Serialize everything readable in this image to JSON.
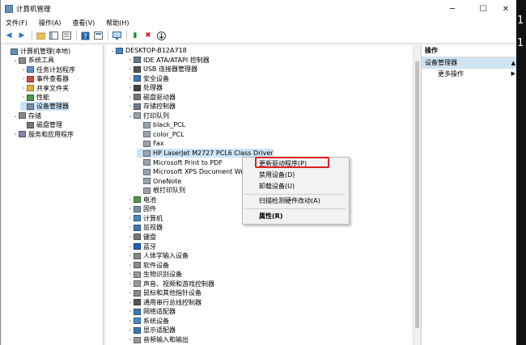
{
  "window": {
    "title": "计算机管理",
    "controls": {
      "minimize": "─",
      "maximize": "☐",
      "close": "✕"
    }
  },
  "menu": [
    "文件(F)",
    "操作(A)",
    "查看(V)",
    "帮助(H)"
  ],
  "left_tree": [
    {
      "label": "计算机管理(本地)",
      "level": 0,
      "icon": "computer-management-icon",
      "expand": ""
    },
    {
      "label": "系统工具",
      "level": 1,
      "icon": "tools-icon",
      "expand": "v"
    },
    {
      "label": "任务计划程序",
      "level": 2,
      "icon": "clock-icon",
      "expand": ">"
    },
    {
      "label": "事件查看器",
      "level": 2,
      "icon": "event-viewer-icon",
      "expand": ">"
    },
    {
      "label": "共享文件夹",
      "level": 2,
      "icon": "shared-folder-icon",
      "expand": ">"
    },
    {
      "label": "性能",
      "level": 2,
      "icon": "performance-icon",
      "expand": ">"
    },
    {
      "label": "设备管理器",
      "level": 2,
      "icon": "device-manager-icon",
      "expand": "",
      "selected": true
    },
    {
      "label": "存储",
      "level": 1,
      "icon": "storage-icon",
      "expand": "v"
    },
    {
      "label": "磁盘管理",
      "level": 2,
      "icon": "disk-icon",
      "expand": ""
    },
    {
      "label": "服务和应用程序",
      "level": 1,
      "icon": "services-icon",
      "expand": ">"
    }
  ],
  "device_tree": {
    "root": "DESKTOP-B12A718",
    "items": [
      {
        "label": "IDE ATA/ATAPI 控制器",
        "level": 1,
        "icon": "ide-controller-icon",
        "expand": ">"
      },
      {
        "label": "USB 连接器管理器",
        "level": 1,
        "icon": "usb-icon",
        "expand": ">"
      },
      {
        "label": "安全设备",
        "level": 1,
        "icon": "security-device-icon",
        "expand": ">"
      },
      {
        "label": "处理器",
        "level": 1,
        "icon": "processor-icon",
        "expand": ">"
      },
      {
        "label": "磁盘驱动器",
        "level": 1,
        "icon": "disk-drive-icon",
        "expand": ">"
      },
      {
        "label": "存储控制器",
        "level": 1,
        "icon": "storage-controller-icon",
        "expand": ">"
      },
      {
        "label": "打印队列",
        "level": 1,
        "icon": "printer-icon",
        "expand": "v"
      },
      {
        "label": "black_PCL",
        "level": 2,
        "icon": "printer-icon",
        "expand": ""
      },
      {
        "label": "color_PCL",
        "level": 2,
        "icon": "printer-icon",
        "expand": ""
      },
      {
        "label": "Fax",
        "level": 2,
        "icon": "printer-icon",
        "expand": ""
      },
      {
        "label": "HP LaserJet M2727 PCL6 Class Driver",
        "level": 2,
        "icon": "printer-icon",
        "expand": "",
        "selected": true
      },
      {
        "label": "Microsoft Print to PDF",
        "level": 2,
        "icon": "printer-icon",
        "expand": ""
      },
      {
        "label": "Microsoft XPS Document Writer",
        "level": 2,
        "icon": "printer-icon",
        "expand": ""
      },
      {
        "label": "OneNote",
        "level": 2,
        "icon": "printer-icon",
        "expand": ""
      },
      {
        "label": "根打印队列",
        "level": 2,
        "icon": "printer-icon",
        "expand": ""
      },
      {
        "label": "电池",
        "level": 1,
        "icon": "battery-icon",
        "expand": ">"
      },
      {
        "label": "固件",
        "level": 1,
        "icon": "firmware-icon",
        "expand": ">"
      },
      {
        "label": "计算机",
        "level": 1,
        "icon": "computer-icon",
        "expand": ">"
      },
      {
        "label": "监视器",
        "level": 1,
        "icon": "monitor-icon",
        "expand": ">"
      },
      {
        "label": "键盘",
        "level": 1,
        "icon": "keyboard-icon",
        "expand": ">"
      },
      {
        "label": "蓝牙",
        "level": 1,
        "icon": "bluetooth-icon",
        "expand": ">"
      },
      {
        "label": "人体学输入设备",
        "level": 1,
        "icon": "hid-icon",
        "expand": ">"
      },
      {
        "label": "软件设备",
        "level": 1,
        "icon": "software-device-icon",
        "expand": ">"
      },
      {
        "label": "生物识别设备",
        "level": 1,
        "icon": "biometric-icon",
        "expand": ">"
      },
      {
        "label": "声音、视频和游戏控制器",
        "level": 1,
        "icon": "sound-icon",
        "expand": ">"
      },
      {
        "label": "鼠标和其他指针设备",
        "level": 1,
        "icon": "mouse-icon",
        "expand": ">"
      },
      {
        "label": "通用串行总线控制器",
        "level": 1,
        "icon": "usb-controller-icon",
        "expand": ">"
      },
      {
        "label": "网络适配器",
        "level": 1,
        "icon": "network-adapter-icon",
        "expand": ">"
      },
      {
        "label": "系统设备",
        "level": 1,
        "icon": "system-device-icon",
        "expand": ">"
      },
      {
        "label": "显示适配器",
        "level": 1,
        "icon": "display-adapter-icon",
        "expand": ">"
      },
      {
        "label": "音频输入和输出",
        "level": 1,
        "icon": "audio-icon",
        "expand": ">"
      }
    ]
  },
  "context_menu": {
    "items": [
      "更新驱动程序(P)",
      "禁用设备(D)",
      "卸载设备(U)",
      "扫描检测硬件改动(A)",
      "属性(R)"
    ],
    "highlight_color": "#e02020"
  },
  "actions": {
    "header": "操作",
    "section": "设备管理器",
    "more": "更多操作"
  },
  "overlay_digits": [
    "1",
    "1"
  ],
  "colors": {
    "selection": "#cce4f7",
    "action_section": "#cfe3f3",
    "highlight_box": "#e02020"
  }
}
